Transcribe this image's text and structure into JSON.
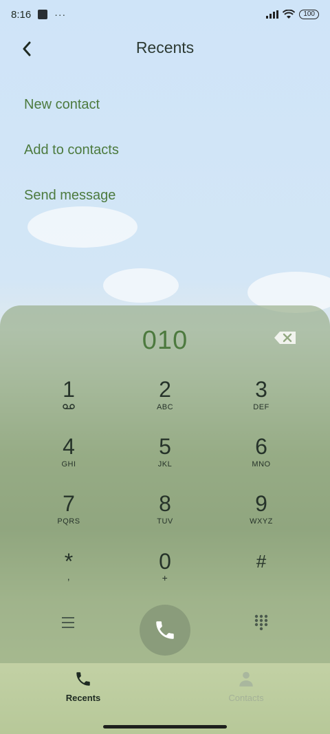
{
  "status_bar": {
    "time": "8:16",
    "more": "···",
    "battery": "100"
  },
  "header": {
    "title": "Recents"
  },
  "menu": [
    {
      "label": "New contact"
    },
    {
      "label": "Add to contacts"
    },
    {
      "label": "Send message"
    }
  ],
  "dialer": {
    "number": "010",
    "keys": [
      {
        "digit": "1",
        "letters": ""
      },
      {
        "digit": "2",
        "letters": "ABC"
      },
      {
        "digit": "3",
        "letters": "DEF"
      },
      {
        "digit": "4",
        "letters": "GHI"
      },
      {
        "digit": "5",
        "letters": "JKL"
      },
      {
        "digit": "6",
        "letters": "MNO"
      },
      {
        "digit": "7",
        "letters": "PQRS"
      },
      {
        "digit": "8",
        "letters": "TUV"
      },
      {
        "digit": "9",
        "letters": "WXYZ"
      },
      {
        "digit": "*",
        "letters": ","
      },
      {
        "digit": "0",
        "letters": "+"
      },
      {
        "digit": "#",
        "letters": ""
      }
    ]
  },
  "nav": {
    "recents": "Recents",
    "contacts": "Contacts"
  },
  "colors": {
    "accent": "#4c7a3e",
    "call_button": "#8a9c7b",
    "dialpad_panel": "#92a880"
  }
}
